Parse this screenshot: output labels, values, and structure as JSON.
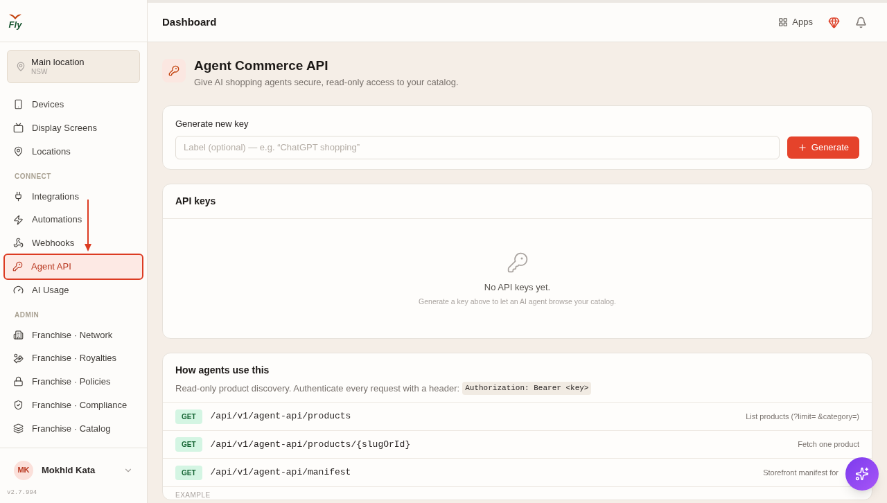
{
  "sidebar": {
    "logo": "Fly",
    "location": {
      "name": "Main location",
      "region": "NSW"
    },
    "groups": [
      {
        "items": [
          {
            "label": "Devices",
            "selected": false,
            "highlighted": false
          },
          {
            "label": "Display Screens",
            "selected": false,
            "highlighted": false
          },
          {
            "label": "Locations",
            "selected": false,
            "highlighted": false
          }
        ]
      },
      {
        "heading": "CONNECT",
        "items": [
          {
            "label": "Integrations",
            "selected": false,
            "highlighted": false
          },
          {
            "label": "Automations",
            "selected": false,
            "highlighted": false
          },
          {
            "label": "Webhooks",
            "selected": false,
            "highlighted": false
          },
          {
            "label": "Agent API",
            "selected": true,
            "highlighted": true
          },
          {
            "label": "AI Usage",
            "selected": false,
            "highlighted": false
          }
        ]
      },
      {
        "heading": "ADMIN",
        "items": [
          {
            "label": "Franchise · Network",
            "selected": false,
            "highlighted": false
          },
          {
            "label": "Franchise · Royalties",
            "selected": false,
            "highlighted": false
          },
          {
            "label": "Franchise · Policies",
            "selected": false,
            "highlighted": false
          },
          {
            "label": "Franchise · Compliance",
            "selected": false,
            "highlighted": false
          },
          {
            "label": "Franchise · Catalog",
            "selected": false,
            "highlighted": false
          }
        ]
      }
    ],
    "user": {
      "initials": "MK",
      "name": "Mokhld Kata"
    },
    "version": "v2.7.994"
  },
  "topbar": {
    "title": "Dashboard",
    "apps": "Apps"
  },
  "page": {
    "title": "Agent Commerce API",
    "subtitle": "Give AI shopping agents secure, read-only access to your catalog."
  },
  "generate": {
    "label": "Generate new key",
    "placeholder": "Label (optional) — e.g. “ChatGPT shopping”",
    "button": "Generate"
  },
  "keys": {
    "title": "API keys",
    "empty_title": "No API keys yet.",
    "empty_hint": "Generate a key above to let an AI agent browse your catalog."
  },
  "usage": {
    "title": "How agents use this",
    "text": "Read-only product discovery. Authenticate every request with a header:",
    "code": "Authorization: Bearer <key>",
    "endpoints": [
      {
        "method": "GET",
        "path": "/api/v1/agent-api/products",
        "description": "List products (?limit= &category=)"
      },
      {
        "method": "GET",
        "path": "/api/v1/agent-api/products/{slugOrId}",
        "description": "Fetch one product"
      },
      {
        "method": "GET",
        "path": "/api/v1/agent-api/manifest",
        "description": "Storefront manifest for"
      }
    ],
    "example_label": "EXAMPLE"
  }
}
